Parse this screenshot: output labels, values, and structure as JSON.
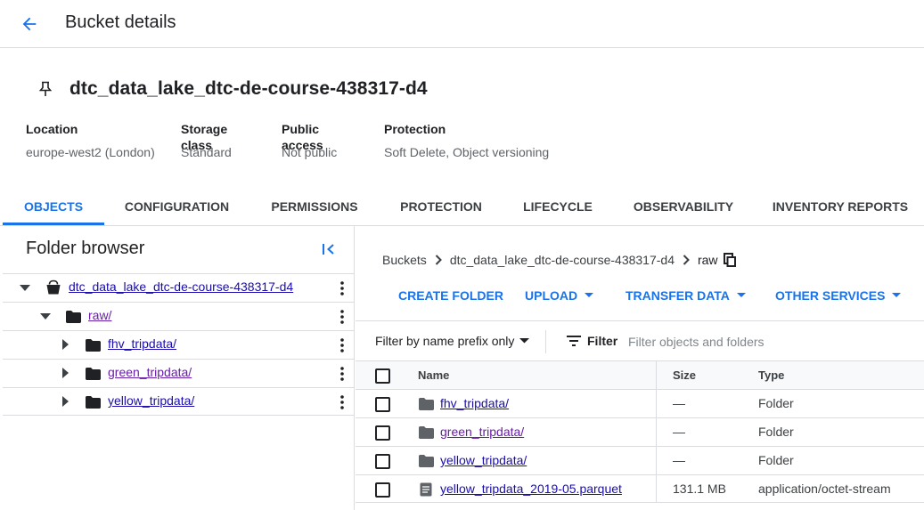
{
  "header": {
    "title": "Bucket details",
    "back_icon": "arrow-back-icon"
  },
  "bucket": {
    "name": "dtc_data_lake_dtc-de-course-438317-d4",
    "pin_icon": "pin-icon"
  },
  "properties": [
    {
      "label": "Location",
      "value": "europe-west2 (London)"
    },
    {
      "label": "Storage class",
      "value": "Standard"
    },
    {
      "label": "Public access",
      "value": "Not public"
    },
    {
      "label": "Protection",
      "value": "Soft Delete, Object versioning"
    }
  ],
  "tabs": [
    {
      "label": "OBJECTS",
      "active": true
    },
    {
      "label": "CONFIGURATION",
      "active": false
    },
    {
      "label": "PERMISSIONS",
      "active": false
    },
    {
      "label": "PROTECTION",
      "active": false
    },
    {
      "label": "LIFECYCLE",
      "active": false
    },
    {
      "label": "OBSERVABILITY",
      "active": false
    },
    {
      "label": "INVENTORY REPORTS",
      "active": false
    }
  ],
  "folder_browser": {
    "title": "Folder browser",
    "tree": [
      {
        "label": "dtc_data_lake_dtc-de-course-438317-d4",
        "kind": "bucket",
        "expanded": true
      },
      {
        "label": "raw/",
        "kind": "folder",
        "expanded": true
      },
      {
        "label": "fhv_tripdata/",
        "kind": "folder",
        "expanded": false
      },
      {
        "label": "green_tripdata/",
        "kind": "folder",
        "expanded": false
      },
      {
        "label": "yellow_tripdata/",
        "kind": "folder",
        "expanded": false
      }
    ]
  },
  "breadcrumb": {
    "items": [
      "Buckets",
      "dtc_data_lake_dtc-de-course-438317-d4",
      "raw"
    ]
  },
  "actions": {
    "create_folder": "CREATE FOLDER",
    "upload": "UPLOAD",
    "transfer_data": "TRANSFER DATA",
    "other_services": "OTHER SERVICES"
  },
  "filter": {
    "mode": "Filter by name prefix only",
    "button": "Filter",
    "placeholder": "Filter objects and folders"
  },
  "table": {
    "columns": {
      "name": "Name",
      "size": "Size",
      "type": "Type"
    },
    "rows": [
      {
        "name": "fhv_tripdata/",
        "size": "—",
        "type": "Folder",
        "kind": "folder"
      },
      {
        "name": "green_tripdata/",
        "size": "—",
        "type": "Folder",
        "kind": "folder"
      },
      {
        "name": "yellow_tripdata/",
        "size": "—",
        "type": "Folder",
        "kind": "folder"
      },
      {
        "name": "yellow_tripdata_2019-05.parquet",
        "size": "131.1 MB",
        "type": "application/octet-stream",
        "kind": "file"
      }
    ]
  },
  "colors": {
    "accent": "#1a73e8",
    "link": "#1a0dab",
    "visited_link": "#681da8",
    "divider": "#dadce0"
  }
}
